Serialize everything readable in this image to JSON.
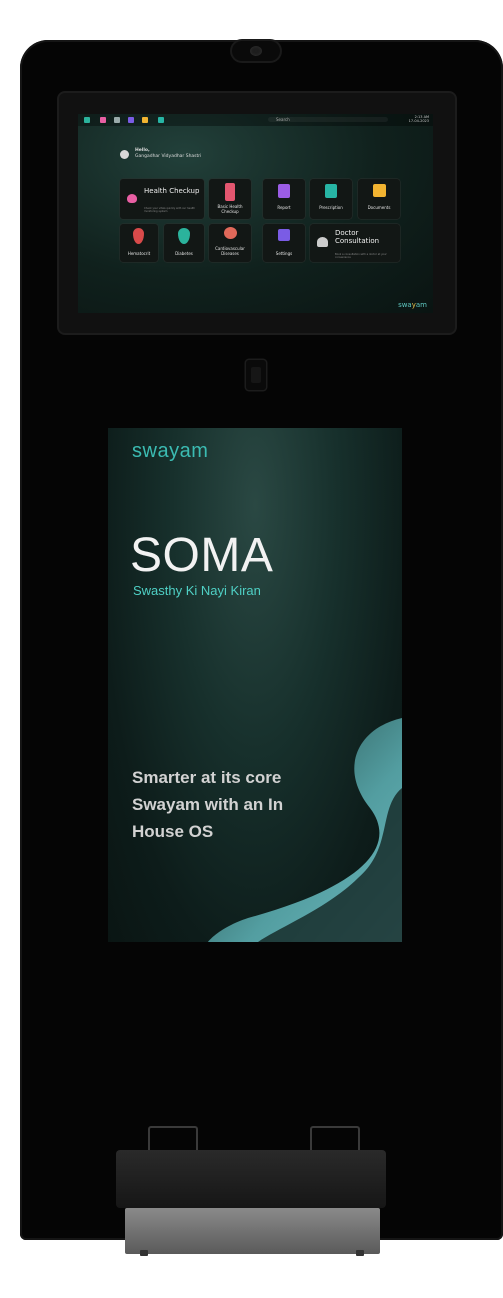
{
  "screen": {
    "topbar": {
      "search_placeholder": "Search",
      "time": "2:13 AM",
      "date": "17-04-2023"
    },
    "greeting": {
      "hello": "Hello,",
      "name": "Gangadhar Vidyadhar Shastri"
    },
    "tiles": [
      {
        "label": "Health Checkup",
        "sub": "Check your vitals quickly with our health monitoring system",
        "icon": "heart-icon",
        "color": "#e85fa3"
      },
      {
        "label": "Basic Health Checkup",
        "icon": "test-tube-icon",
        "color": "#e3566f"
      },
      {
        "label": "Report",
        "icon": "report-icon",
        "color": "#9b5de5"
      },
      {
        "label": "Prescription",
        "icon": "prescription-icon",
        "color": "#27b5a5"
      },
      {
        "label": "Documents",
        "icon": "folder-icon",
        "color": "#f2b431"
      },
      {
        "label": "Hematocrit",
        "icon": "blood-drop-icon",
        "color": "#d84a4a"
      },
      {
        "label": "Diabetes",
        "icon": "diabetes-drop-icon",
        "color": "#2bb39c"
      },
      {
        "label": "Cardiovascular Diseases",
        "icon": "heart-organ-icon",
        "color": "#e0695a"
      },
      {
        "label": "Settings",
        "icon": "settings-chip-icon",
        "color": "#7a5ce5"
      },
      {
        "label": "Doctor Consultation",
        "sub": "Book a consultation with a doctor at your convenience",
        "icon": "doctor-icon",
        "color": "#cccccc"
      }
    ],
    "brand": "swa",
    "brand_mark": "y",
    "brand_end": "am"
  },
  "poster": {
    "brand": "swayam",
    "title": "SOMA",
    "tagline": "Swasthy Ki Nayi Kiran",
    "copy_lines": [
      "Smarter at its core",
      "Swayam with an In",
      "House OS"
    ],
    "accent": "#3bbbb2"
  }
}
